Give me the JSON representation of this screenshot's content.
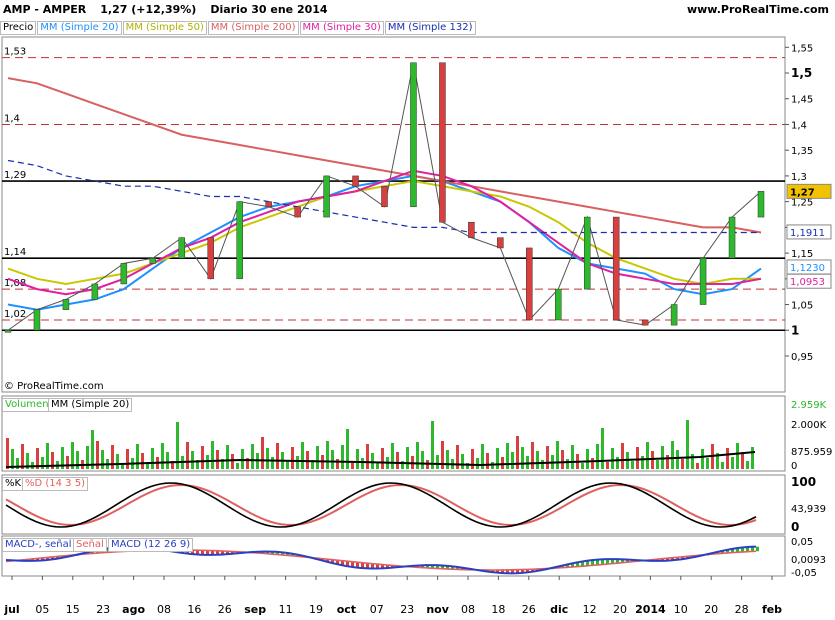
{
  "header": {
    "ticker": "AMP - AMPER",
    "price": "1,27 (+12,39%)",
    "period": "Diario  30 ene 2014",
    "site": "www.ProRealTime.com"
  },
  "legend": {
    "price_label": "Precio",
    "ma20": "MM (Simple 20)",
    "ma50": "MM (Simple 50)",
    "ma200": "MM (Simple 200)",
    "ma30": "MM (Simple 30)",
    "ma132": "MM (Simple 132)"
  },
  "copyright": "© ProRealTime.com",
  "volume_panel": {
    "label": "Volumen",
    "ma_label": "MM (Simple 20)",
    "last": "2.959K",
    "ma_value": "875.959",
    "tick": "2.000K",
    "zero": "0"
  },
  "stoch_panel": {
    "k_label": "%K",
    "d_label": "%D (14 3 5)",
    "value": "43,939",
    "tick100": "100",
    "tick0": "0"
  },
  "macd_panel": {
    "signal_label": "MACD-, señal",
    "senal_label": "Señal",
    "macd_label": "MACD (12 26 9)",
    "value": "0,0093",
    "tick": "0,05",
    "zero": "0",
    "tick_neg": "-0,05"
  },
  "colors": {
    "ma20": "#1e90ff",
    "ma50": "#c8c800",
    "ma200": "#d86060",
    "ma30": "#e020a0",
    "ma132": "#1a2fb0",
    "up": "#2db82d",
    "down": "#d84040",
    "stoch_d": "#e06060",
    "macd": "#2a40c0",
    "signal": "#e06060"
  },
  "chart_data": {
    "type": "line",
    "title": "AMP - AMPER",
    "x_tick_labels": [
      "jul",
      "05",
      "15",
      "23",
      "ago",
      "08",
      "16",
      "26",
      "sep",
      "11",
      "19",
      "oct",
      "07",
      "23",
      "nov",
      "08",
      "18",
      "26",
      "dic",
      "12",
      "20",
      "2014",
      "10",
      "20",
      "28",
      "feb"
    ],
    "ylim": [
      0.88,
      1.57
    ],
    "y_ticks": [
      "1,55",
      "1,5",
      "1,45",
      "1,4",
      "1,35",
      "1,3",
      "1,25",
      "1,2",
      "1,15",
      "1,1",
      "1,05",
      "1",
      "0,95"
    ],
    "left_levels": [
      "1,53",
      "1,4",
      "1,29",
      "1,14",
      "1,08",
      "1,02"
    ],
    "right_tags": [
      "1,27",
      "1,1911",
      "1,1230",
      "1,0953"
    ],
    "last_close": 1.27,
    "series": [
      {
        "name": "MM (Simple 20)",
        "values": [
          1.05,
          1.04,
          1.05,
          1.06,
          1.08,
          1.12,
          1.16,
          1.19,
          1.22,
          1.24,
          1.25,
          1.26,
          1.28,
          1.29,
          1.3,
          1.29,
          1.27,
          1.25,
          1.21,
          1.16,
          1.13,
          1.12,
          1.11,
          1.08,
          1.07,
          1.08,
          1.12
        ]
      },
      {
        "name": "MM (Simple 50)",
        "values": [
          1.12,
          1.1,
          1.09,
          1.1,
          1.11,
          1.13,
          1.15,
          1.17,
          1.2,
          1.22,
          1.24,
          1.26,
          1.27,
          1.28,
          1.29,
          1.28,
          1.27,
          1.26,
          1.24,
          1.21,
          1.17,
          1.14,
          1.12,
          1.1,
          1.09,
          1.1,
          1.1
        ]
      },
      {
        "name": "MM (Simple 200)",
        "values": [
          1.49,
          1.48,
          1.46,
          1.44,
          1.42,
          1.4,
          1.38,
          1.37,
          1.36,
          1.35,
          1.34,
          1.33,
          1.32,
          1.31,
          1.3,
          1.29,
          1.28,
          1.27,
          1.26,
          1.25,
          1.24,
          1.23,
          1.22,
          1.21,
          1.2,
          1.2,
          1.19
        ]
      },
      {
        "name": "MM (Simple 30)",
        "values": [
          1.1,
          1.08,
          1.07,
          1.08,
          1.1,
          1.13,
          1.16,
          1.18,
          1.21,
          1.23,
          1.25,
          1.26,
          1.27,
          1.29,
          1.31,
          1.3,
          1.28,
          1.25,
          1.21,
          1.17,
          1.13,
          1.11,
          1.1,
          1.09,
          1.09,
          1.09,
          1.1
        ]
      },
      {
        "name": "MM (Simple 132)",
        "values": [
          1.33,
          1.32,
          1.3,
          1.29,
          1.28,
          1.28,
          1.27,
          1.26,
          1.26,
          1.25,
          1.24,
          1.23,
          1.22,
          1.21,
          1.2,
          1.2,
          1.19,
          1.19,
          1.19,
          1.19,
          1.19,
          1.19,
          1.19,
          1.19,
          1.19,
          1.19,
          1.19
        ]
      },
      {
        "name": "Precio",
        "values": [
          1.0,
          1.04,
          1.06,
          1.09,
          1.13,
          1.14,
          1.18,
          1.1,
          1.25,
          1.24,
          1.22,
          1.3,
          1.28,
          1.24,
          1.52,
          1.21,
          1.18,
          1.16,
          1.02,
          1.08,
          1.22,
          1.02,
          1.01,
          1.05,
          1.14,
          1.22,
          1.27
        ]
      }
    ]
  }
}
